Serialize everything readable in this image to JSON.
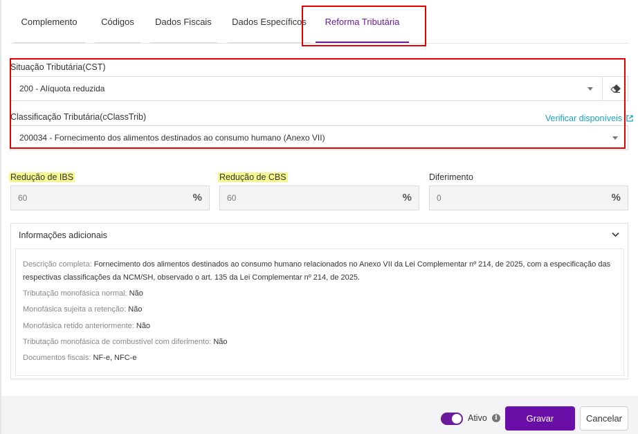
{
  "tabs": [
    {
      "label": "Complemento"
    },
    {
      "label": "Códigos"
    },
    {
      "label": "Dados Fiscais"
    },
    {
      "label": "Dados Específicos"
    },
    {
      "label": "Reforma Tributária"
    }
  ],
  "active_tab_index": 4,
  "cst": {
    "label": "Situação Tributária(CST)",
    "value": "200 - Alíquota reduzida"
  },
  "cclass": {
    "label": "Classificação Tributária(cClassTrib)",
    "link": "Verificar disponíveis",
    "value": "200034 - Fornecimento dos alimentos destinados ao consumo humano (Anexo VII)"
  },
  "ibs": {
    "label": "Redução de IBS",
    "value": "60",
    "unit": "%"
  },
  "cbs": {
    "label": "Redução de CBS",
    "value": "60",
    "unit": "%"
  },
  "diferimento": {
    "label": "Diferimento",
    "value": "0",
    "unit": "%"
  },
  "info": {
    "title": "Informações adicionais",
    "rows": [
      {
        "key": "Descrição completa:",
        "value": "Fornecimento dos alimentos destinados ao consumo humano relacionados no Anexo VII da Lei Complementar nº 214, de 2025, com a especificação das respectivas classificações da NCM/SH, observado o art. 135 da Lei Complementar nº 214, de 2025."
      },
      {
        "key": "Tributação monofásica normal:",
        "value": "Não"
      },
      {
        "key": "Monofásica sujeita a retenção:",
        "value": "Não"
      },
      {
        "key": "Monofásica retido anteriormente:",
        "value": "Não"
      },
      {
        "key": "Tributação monofásica de combustível com diferimento:",
        "value": "Não"
      },
      {
        "key": "Documentos fiscais:",
        "value": "NF-e, NFC-e"
      }
    ]
  },
  "footer": {
    "toggle_label": "Ativo",
    "toggle_on": true,
    "save_label": "Gravar",
    "cancel_label": "Cancelar"
  },
  "colors": {
    "accent": "#6a0ea8",
    "link": "#1aa3c8",
    "highlight": "#f7f78e",
    "annotation_box": "#e50000"
  }
}
